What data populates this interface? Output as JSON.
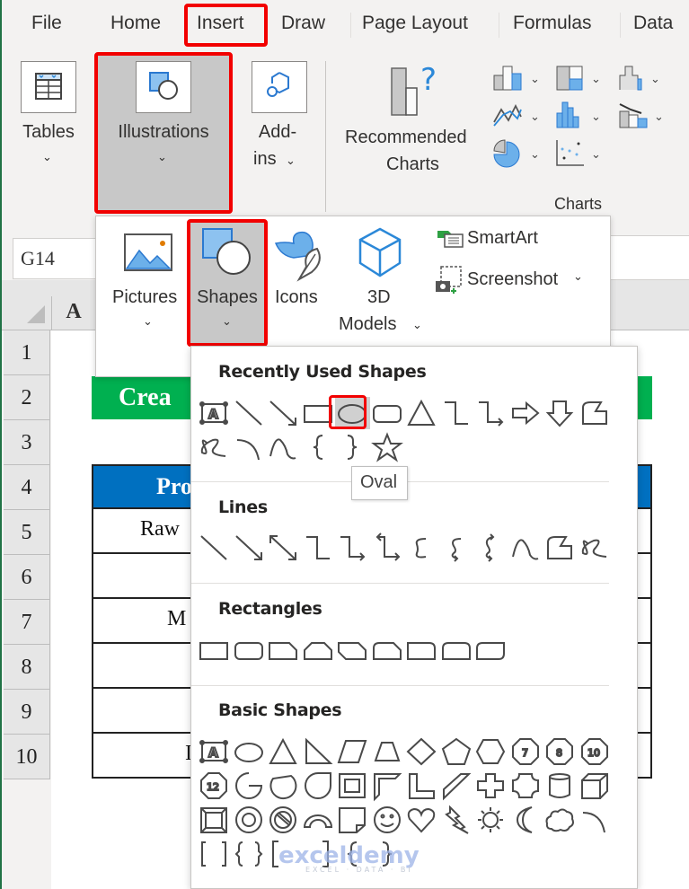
{
  "tabs": [
    {
      "label": "File"
    },
    {
      "label": "Home"
    },
    {
      "label": "Insert",
      "active": true
    },
    {
      "label": "Draw"
    },
    {
      "label": "Page Layout"
    },
    {
      "label": "Formulas"
    },
    {
      "label": "Data"
    }
  ],
  "ribbon": {
    "tables_label": "Tables",
    "illustrations_label": "Illustrations",
    "addins_label_1": "Add-",
    "addins_label_2": "ins",
    "recommended_charts_1": "Recommended",
    "recommended_charts_2": "Charts",
    "charts_group_label": "Charts",
    "chevron": "⌄"
  },
  "illustrations_menu": {
    "pictures": "Pictures",
    "shapes": "Shapes",
    "icons": "Icons",
    "models_1": "3D",
    "models_2": "Models",
    "smartart": "SmartArt",
    "screenshot": "Screenshot"
  },
  "name_box": "G14",
  "column_header": "A",
  "rows": [
    "1",
    "2",
    "3",
    "4",
    "5",
    "6",
    "7",
    "8",
    "9",
    "10"
  ],
  "sheet": {
    "title_partial": "Crea",
    "table_header_partial": "Pro",
    "cells": [
      {
        "row": 5,
        "text": "Raw"
      },
      {
        "row": 6,
        "text": ""
      },
      {
        "row": 7,
        "text": "M"
      },
      {
        "row": 8,
        "text": ""
      },
      {
        "row": 9,
        "text": ""
      },
      {
        "row": 10,
        "text": "I"
      }
    ],
    "colors": {
      "title_bg": "#00b050",
      "header_bg": "#0070c0"
    }
  },
  "shapes_gallery": {
    "sections": {
      "recent": "Recently Used Shapes",
      "lines": "Lines",
      "rectangles": "Rectangles",
      "basic": "Basic Shapes"
    },
    "selected_shape": "Oval",
    "tooltip": "Oval",
    "recent_row1": [
      "Text Box",
      "Line",
      "Line Arrow",
      "Rectangle",
      "Oval",
      "Rectangle: Rounded Corners",
      "Isosceles Triangle",
      "Connector: Elbow",
      "Connector: Elbow Arrow",
      "Arrow: Right",
      "Arrow: Down",
      "Freeform: Shape"
    ],
    "recent_row2": [
      "Freeform: Scribble",
      "Arc",
      "Curve",
      "Left Brace",
      "Right Brace",
      "Star: 5 Points"
    ],
    "lines": [
      "Line",
      "Line Arrow",
      "Line Arrow: Double",
      "Connector: Elbow",
      "Connector: Elbow Arrow",
      "Connector: Elbow Double-Arrow",
      "Connector: Curved",
      "Connector: Curved Arrow",
      "Connector: Curved Double-Arrow",
      "Curve",
      "Freeform: Shape",
      "Freeform: Scribble"
    ],
    "rectangles": [
      "Rectangle",
      "Rectangle: Rounded Corners",
      "Rectangle: Single Corner Snipped",
      "Rectangle: Top Corners Snipped",
      "Rectangle: Diagonal Corners Snipped",
      "Rectangle: Top Corners One Rounded One Snipped",
      "Rectangle: Single Corner Rounded",
      "Rectangle: Top Corners Rounded",
      "Rectangle: Diagonal Corners Rounded"
    ],
    "basic_row1": [
      "Text Box",
      "Oval",
      "Isosceles Triangle",
      "Right Triangle",
      "Parallelogram",
      "Trapezoid",
      "Diamond",
      "Pentagon",
      "Hexagon",
      "Heptagon",
      "Octagon",
      "Decagon"
    ],
    "basic_row2": [
      "Dodecagon",
      "Partial Circle",
      "Chord",
      "Teardrop",
      "Frame",
      "Half Frame",
      "L-Shape",
      "Diagonal Stripe",
      "Cross",
      "Plaque",
      "Cylinder",
      "Cube"
    ],
    "basic_row3": [
      "Bevel",
      "Donut",
      "No Symbol",
      "Block Arc",
      "Folded Corner",
      "Smiley Face",
      "Heart",
      "Lightning Bolt",
      "Sun",
      "Moon",
      "Cloud",
      "Arc"
    ],
    "basic_row4": [
      "Double Bracket",
      "Double Brace",
      "Left Bracket",
      "Right Bracket",
      "Left Brace",
      "Right Brace"
    ],
    "polygon_labels": {
      "heptagon": "7",
      "octagon": "8",
      "decagon": "10",
      "dodecagon": "12"
    },
    "textbox_glyph": "A"
  },
  "watermark": {
    "brand": "exceldemy",
    "tagline": "EXCEL · DATA · BI"
  }
}
